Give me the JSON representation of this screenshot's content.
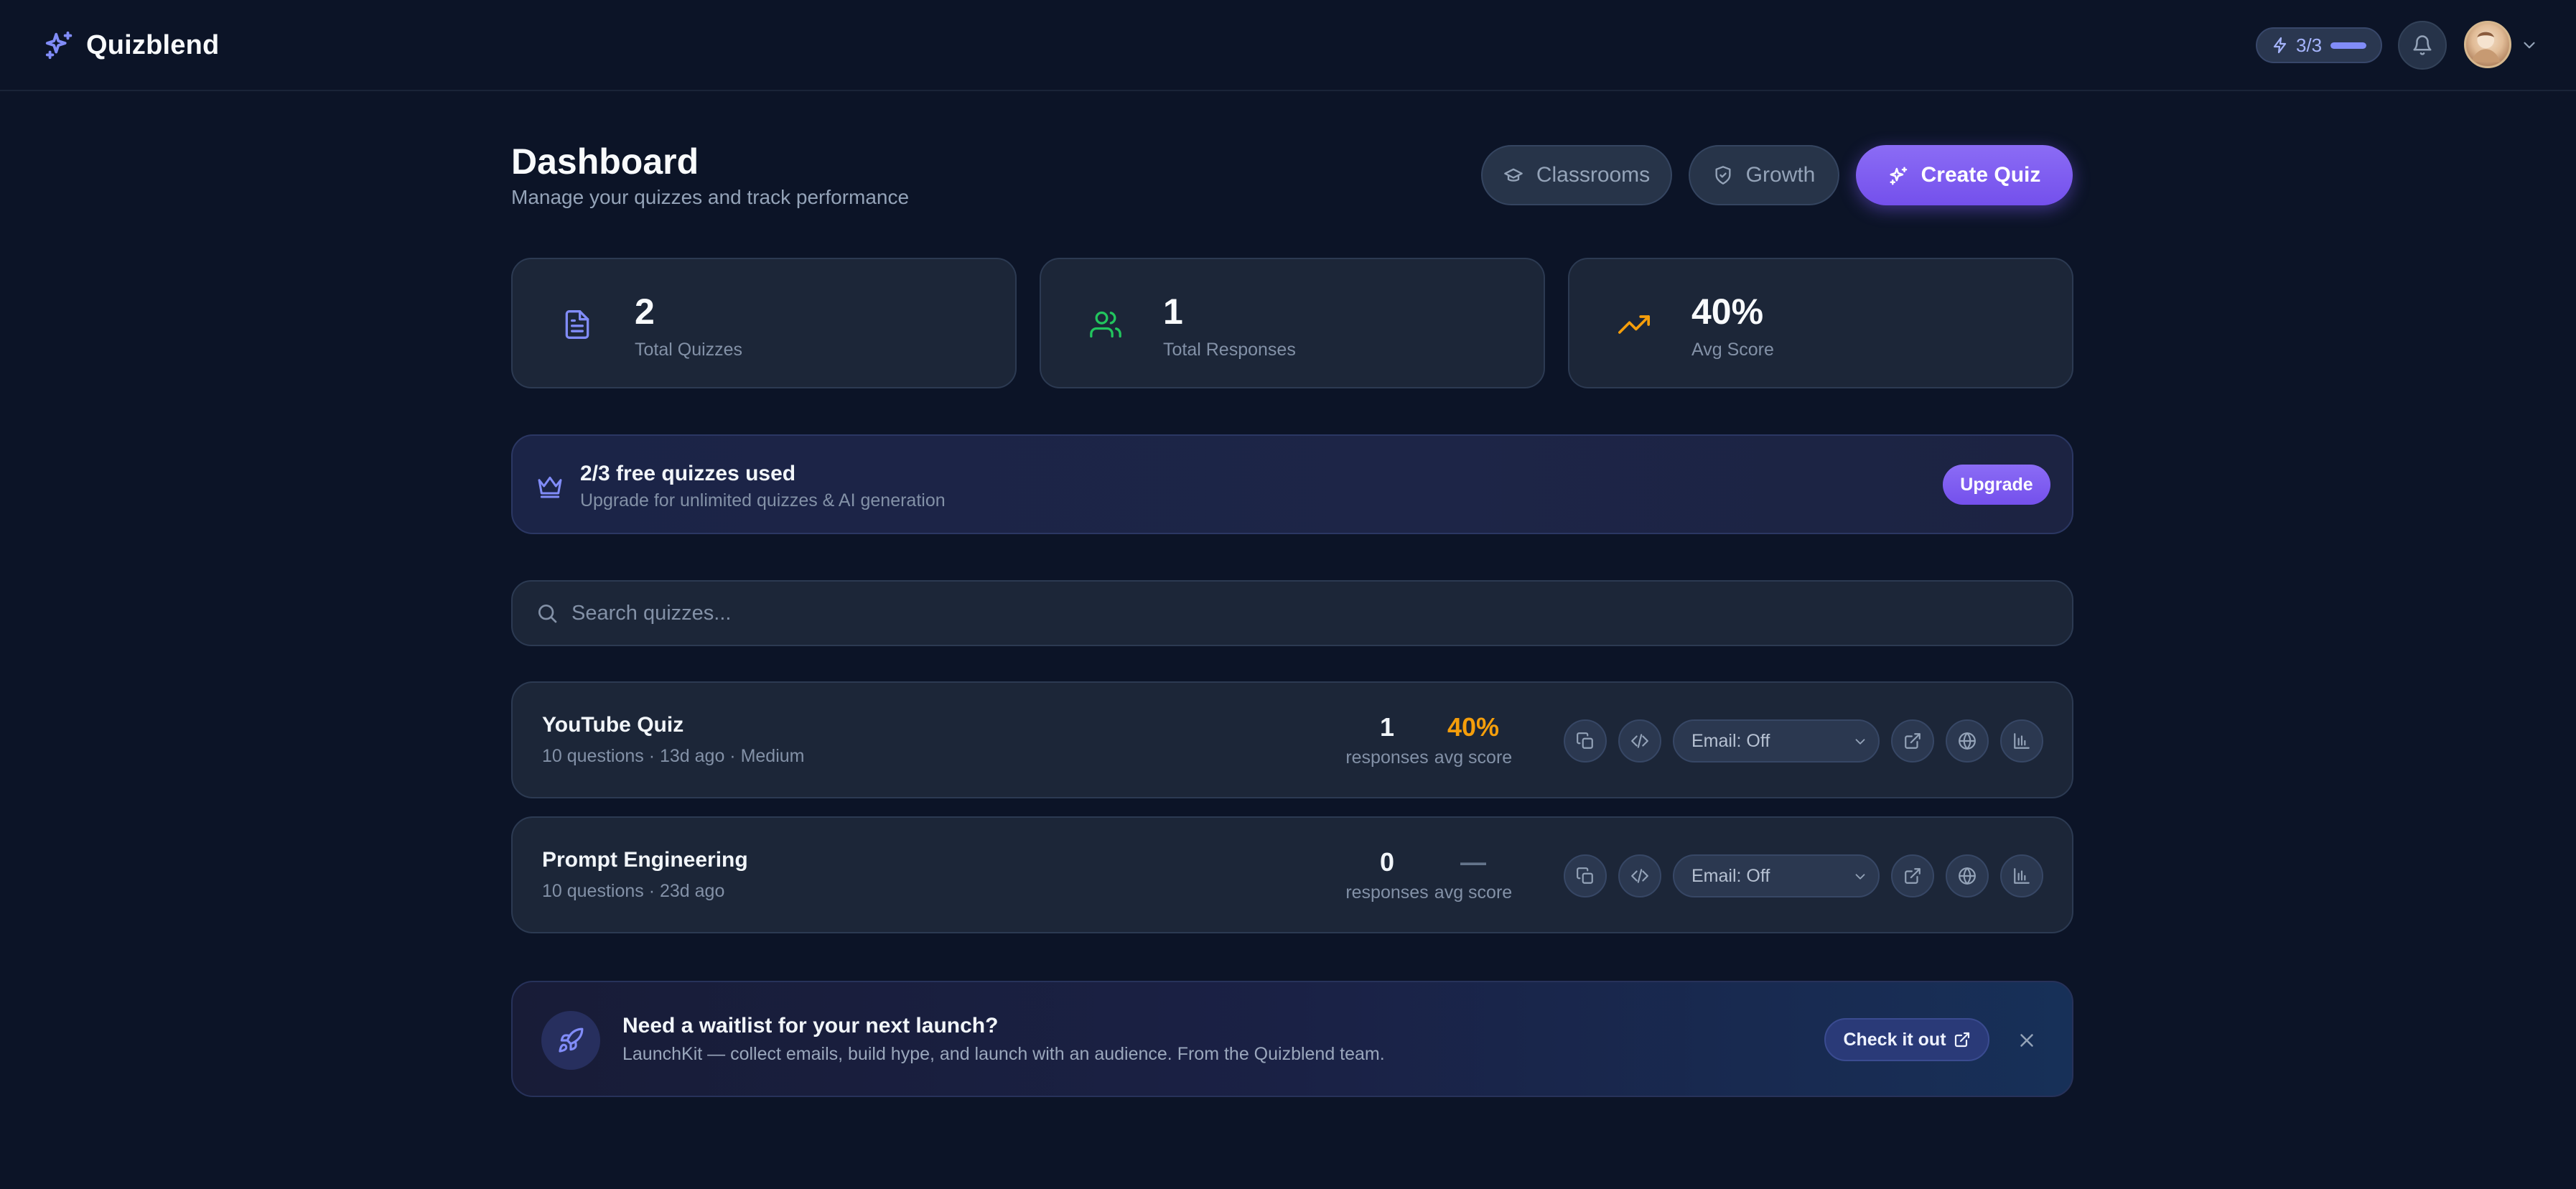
{
  "app": {
    "name": "Quizblend",
    "usage": {
      "count": "3/3",
      "progress": 1.0
    },
    "icons": {
      "brand": "sparkles-icon",
      "bell": "bell-icon",
      "avatar_menu": "chevron-down-icon"
    }
  },
  "header": {
    "title": "Dashboard",
    "subtitle": "Manage your quizzes and track performance",
    "buttons": {
      "classrooms": "Classrooms",
      "growth": "Growth",
      "create": "Create Quiz"
    }
  },
  "stats": [
    {
      "value": "2",
      "label": "Total Quizzes",
      "icon": "file-text-icon",
      "color": "#818cf8"
    },
    {
      "value": "1",
      "label": "Total Responses",
      "icon": "users-icon",
      "color": "#22c55e"
    },
    {
      "value": "40%",
      "label": "Avg Score",
      "icon": "trending-up-icon",
      "color": "#f59e0b"
    }
  ],
  "upgrade": {
    "title": "2/3 free quizzes used",
    "subtitle": "Upgrade for unlimited quizzes & AI generation",
    "button": "Upgrade"
  },
  "search": {
    "placeholder": "Search quizzes..."
  },
  "quizzes": [
    {
      "title": "YouTube Quiz",
      "meta": "10 questions · 13d ago · Medium",
      "responses": "1",
      "responses_label": "responses",
      "avg_score": "40%",
      "avg_label": "avg score",
      "email": "Email: Off"
    },
    {
      "title": "Prompt Engineering",
      "meta": "10 questions · 23d ago",
      "responses": "0",
      "responses_label": "responses",
      "avg_score": "—",
      "avg_label": "avg score",
      "email": "Email: Off"
    }
  ],
  "promo": {
    "title": "Need a waitlist for your next launch?",
    "subtitle": "LaunchKit — collect emails, build hype, and launch with an audience. From the Quizblend team.",
    "button": "Check it out"
  },
  "colors": {
    "background": "#0c1427",
    "accent": "#7c5cf6",
    "score": "#f59e0b"
  }
}
